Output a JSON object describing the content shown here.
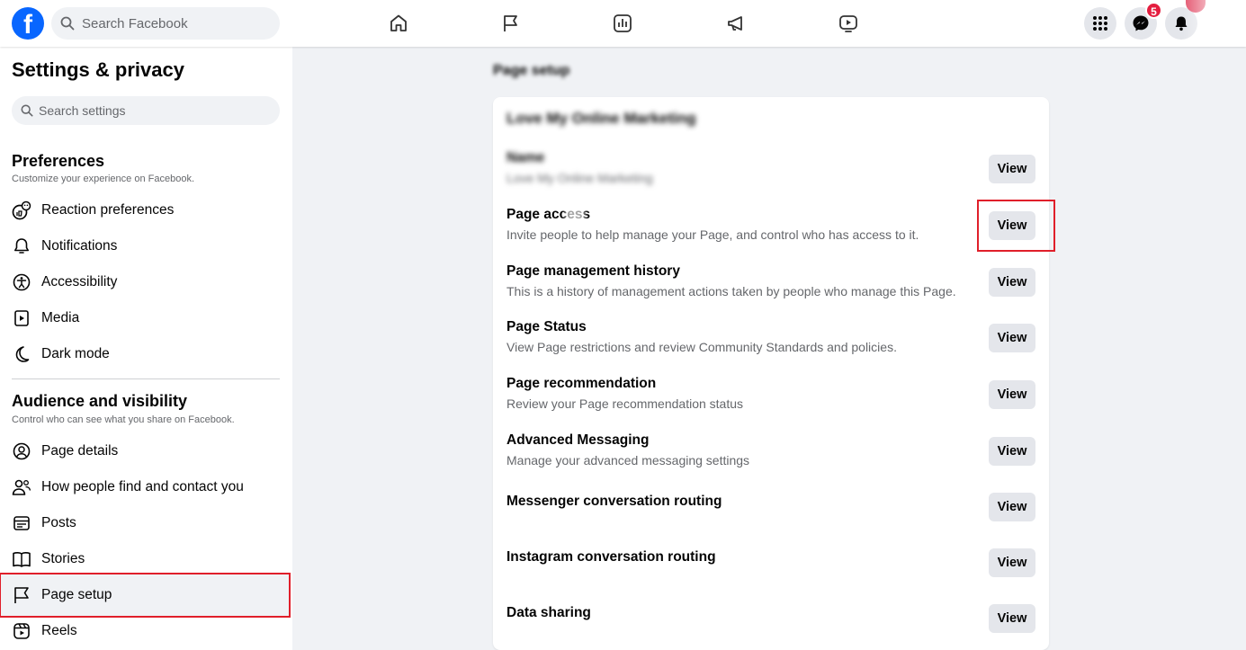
{
  "topbar": {
    "logo_letter": "f",
    "search_placeholder": "Search Facebook",
    "nav_icons": [
      "home-icon",
      "flag-icon",
      "insights-icon",
      "megaphone-icon",
      "video-icon"
    ],
    "messenger_badge": "5",
    "brand_color": "#0866ff",
    "badge_color": "#e41e3f"
  },
  "sidebar": {
    "title": "Settings & privacy",
    "search_placeholder": "Search settings",
    "sections": [
      {
        "title": "Preferences",
        "subtitle": "Customize your experience on Facebook.",
        "items": [
          {
            "label": "Reaction preferences",
            "icon": "reaction-icon"
          },
          {
            "label": "Notifications",
            "icon": "bell-icon"
          },
          {
            "label": "Accessibility",
            "icon": "accessibility-icon"
          },
          {
            "label": "Media",
            "icon": "media-icon"
          },
          {
            "label": "Dark mode",
            "icon": "moon-icon"
          }
        ]
      },
      {
        "title": "Audience and visibility",
        "subtitle": "Control who can see what you share on Facebook.",
        "items": [
          {
            "label": "Page details",
            "icon": "user-circle-icon"
          },
          {
            "label": "How people find and contact you",
            "icon": "people-icon"
          },
          {
            "label": "Posts",
            "icon": "posts-icon"
          },
          {
            "label": "Stories",
            "icon": "stories-icon"
          },
          {
            "label": "Page setup",
            "icon": "flag-icon",
            "active": true
          },
          {
            "label": "Reels",
            "icon": "reels-icon"
          }
        ]
      }
    ],
    "highlight_color": "#e01f2a"
  },
  "main": {
    "title": "Page setup",
    "card_title": "Love My Online Marketing",
    "rows": [
      {
        "title": "Name",
        "desc": "Love My Online Marketing",
        "button": "View",
        "blurred": true
      },
      {
        "title": "Page access",
        "desc": "Invite people to help manage your Page, and control who has access to it.",
        "button": "View",
        "highlighted": true
      },
      {
        "title": "Page management history",
        "desc": "This is a history of management actions taken by people who manage this Page.",
        "button": "View"
      },
      {
        "title": "Page Status",
        "desc": "View Page restrictions and review Community Standards and policies.",
        "button": "View"
      },
      {
        "title": "Page recommendation",
        "desc": "Review your Page recommendation status",
        "button": "View"
      },
      {
        "title": "Advanced Messaging",
        "desc": "Manage your advanced messaging settings",
        "button": "View"
      },
      {
        "title": "Messenger conversation routing",
        "desc": "",
        "button": "View"
      },
      {
        "title": "Instagram conversation routing",
        "desc": "",
        "button": "View"
      },
      {
        "title": "Data sharing",
        "desc": "",
        "button": "View"
      }
    ]
  }
}
